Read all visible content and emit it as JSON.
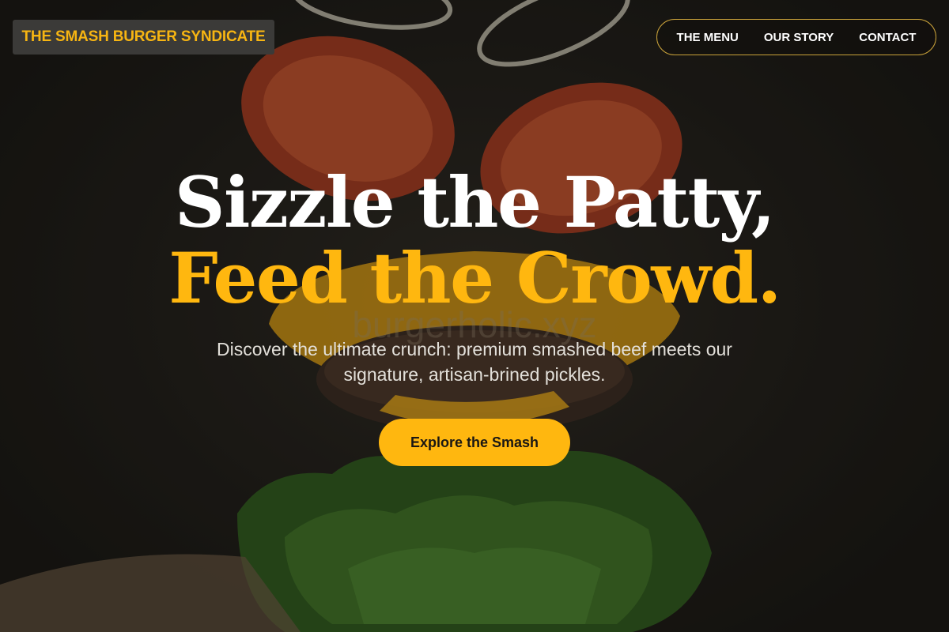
{
  "brand": {
    "name": "THE SMASH BURGER SYNDICATE"
  },
  "nav": {
    "items": [
      {
        "label": "THE MENU"
      },
      {
        "label": "OUR STORY"
      },
      {
        "label": "CONTACT"
      }
    ]
  },
  "hero": {
    "headline_line1": "Sizzle the Patty,",
    "headline_line2": "Feed the Crowd.",
    "watermark": "burgerholic.xyz",
    "subtitle": "Discover the ultimate crunch: premium smashed beef meets our signature, artisan-brined pickles.",
    "cta_label": "Explore the Smash"
  },
  "colors": {
    "accent": "#ffb70f",
    "background": "#1c1a17",
    "brand_box": "#3b3a38",
    "nav_border": "#c9a23a"
  },
  "icons": {
    "hero_image": "floating-burger-ingredients-photo"
  }
}
